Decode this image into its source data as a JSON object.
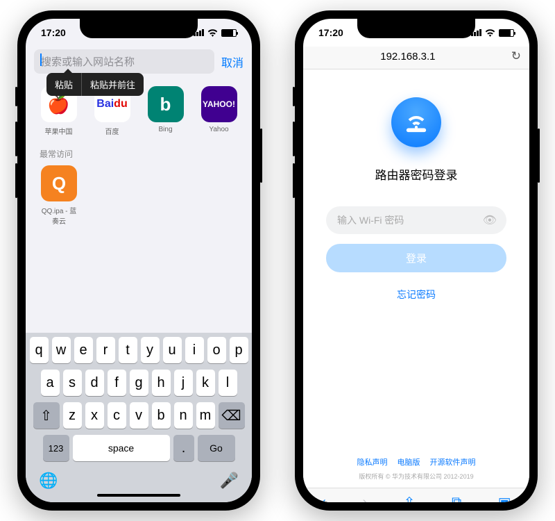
{
  "status": {
    "time": "17:20",
    "loc_icon": "location-arrow"
  },
  "left": {
    "search_placeholder": "搜索或输入网站名称",
    "cancel": "取消",
    "ctx": {
      "paste": "粘贴",
      "paste_go": "粘贴并前往"
    },
    "favorites": [
      {
        "label": "苹果中国",
        "icon_name": "apple-icon"
      },
      {
        "label": "百度",
        "icon_name": "baidu-icon"
      },
      {
        "label": "Bing",
        "icon_name": "bing-icon"
      },
      {
        "label": "Yahoo",
        "icon_name": "yahoo-icon"
      }
    ],
    "frequent_header": "最常访问",
    "frequent": [
      {
        "label": "QQ.ipa - 蓝奏云",
        "letter": "Q",
        "color": "#f58220"
      }
    ],
    "keyboard": {
      "row1": [
        "q",
        "w",
        "e",
        "r",
        "t",
        "y",
        "u",
        "i",
        "o",
        "p"
      ],
      "row2": [
        "a",
        "s",
        "d",
        "f",
        "g",
        "h",
        "j",
        "k",
        "l"
      ],
      "row3": [
        "z",
        "x",
        "c",
        "v",
        "b",
        "n",
        "m"
      ],
      "n123": "123",
      "space": "space",
      "dot": ".",
      "go": "Go"
    }
  },
  "right": {
    "url": "192.168.3.1",
    "title": "路由器密码登录",
    "pw_placeholder": "输入 Wi-Fi 密码",
    "login": "登录",
    "forgot": "忘记密码",
    "links": [
      "隐私声明",
      "电脑版",
      "开源软件声明"
    ],
    "copyright": "版权所有 © 华为技术有限公司 2012-2019"
  }
}
